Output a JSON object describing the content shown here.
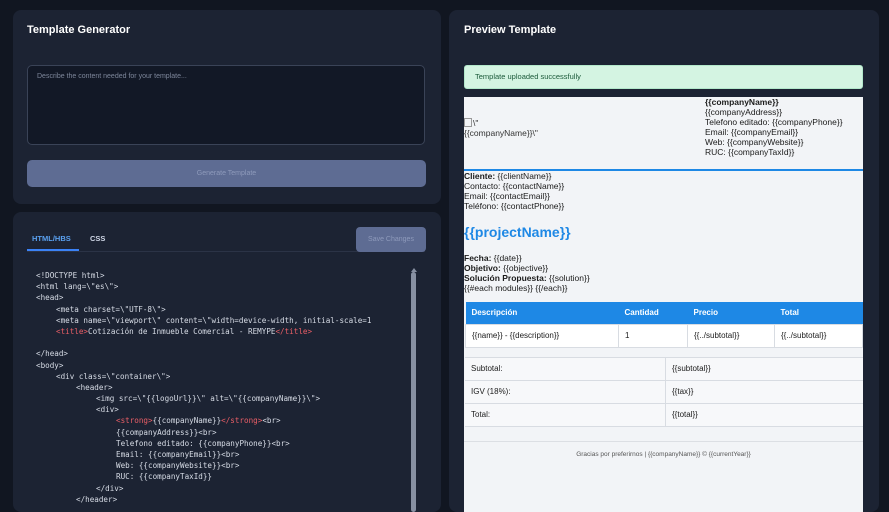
{
  "generator": {
    "title": "Template Generator",
    "placeholder": "Describe the content needed for your template...",
    "generate_label": "Generate Template"
  },
  "editor": {
    "tabs": [
      "HTML/HBS",
      "CSS"
    ],
    "save_label": "Save Changes",
    "code_lines": [
      {
        "i": 0,
        "p": [
          [
            "",
            "<!DOCTYPE html>"
          ]
        ]
      },
      {
        "i": 0,
        "p": [
          [
            "",
            "<html lang=\\\"es\\\">"
          ]
        ]
      },
      {
        "i": 0,
        "p": [
          [
            "",
            "<head>"
          ]
        ]
      },
      {
        "i": 1,
        "p": [
          [
            "",
            "<meta charset=\\\"UTF-8\\\">"
          ]
        ]
      },
      {
        "i": 1,
        "p": [
          [
            "",
            "<meta name=\\\"viewport\\\" content=\\\"width=device-width, initial-scale=1"
          ]
        ]
      },
      {
        "i": 1,
        "p": [
          [
            "t",
            "<title>"
          ],
          [
            "",
            "Cotización de Inmueble Comercial - REMYPE"
          ],
          [
            "t",
            "</title>"
          ]
        ]
      },
      {
        "i": 0,
        "p": [
          [
            "",
            ""
          ]
        ]
      },
      {
        "i": 0,
        "p": [
          [
            "",
            "</head>"
          ]
        ]
      },
      {
        "i": 0,
        "p": [
          [
            "",
            "<body>"
          ]
        ]
      },
      {
        "i": 1,
        "p": [
          [
            "",
            "<div class=\\\"container\\\">"
          ]
        ]
      },
      {
        "i": 2,
        "p": [
          [
            "",
            "<header>"
          ]
        ]
      },
      {
        "i": 3,
        "p": [
          [
            "",
            "<img src=\\\"{{logoUrl}}\\\" alt=\\\"{{companyName}}\\\">"
          ]
        ]
      },
      {
        "i": 3,
        "p": [
          [
            "",
            "<div>"
          ]
        ]
      },
      {
        "i": 4,
        "p": [
          [
            "t",
            "<strong>"
          ],
          [
            "",
            "{{companyName}}"
          ],
          [
            "t",
            "</strong>"
          ],
          [
            "",
            "<br>"
          ]
        ]
      },
      {
        "i": 4,
        "p": [
          [
            "",
            "{{companyAddress}}<br>"
          ]
        ]
      },
      {
        "i": 4,
        "p": [
          [
            "",
            "Telefono editado: {{companyPhone}}<br>"
          ]
        ]
      },
      {
        "i": 4,
        "p": [
          [
            "",
            "Email: {{companyEmail}}<br>"
          ]
        ]
      },
      {
        "i": 4,
        "p": [
          [
            "",
            "Web: {{companyWebsite}}<br>"
          ]
        ]
      },
      {
        "i": 4,
        "p": [
          [
            "",
            "RUC: {{companyTaxId}}"
          ]
        ]
      },
      {
        "i": 3,
        "p": [
          [
            "",
            "</div>"
          ]
        ]
      },
      {
        "i": 2,
        "p": [
          [
            "",
            "</header>"
          ]
        ]
      }
    ]
  },
  "preview": {
    "title": "Preview Template",
    "toast": "Template uploaded successfully",
    "logo_alt_1": "\\\"",
    "logo_alt_2": "{{companyName}}\\\"",
    "company": {
      "name": "{{companyName}}",
      "address": "{{companyAddress}}",
      "phone": "Telefono editado: {{companyPhone}}",
      "email": "Email: {{companyEmail}}",
      "web": "Web: {{companyWebsite}}",
      "ruc": "RUC: {{companyTaxId}}"
    },
    "client": {
      "cliente_label": "Cliente:",
      "cliente_value": " {{clientName}}",
      "contacto": "Contacto: {{contactName}}",
      "email": "Email: {{contactEmail}}",
      "telefono": "Teléfono: {{contactPhone}}"
    },
    "project_name": "{{projectName}}",
    "fecha_label": "Fecha:",
    "fecha_value": " {{date}}",
    "objetivo_label": "Objetivo:",
    "objetivo_value": " {{objective}}",
    "solucion_label": "Solución Propuesta:",
    "solucion_value": " {{solution}}",
    "each_line": "{{#each modules}} {{/each}}",
    "table_headers": [
      "Descripción",
      "Cantidad",
      "Precio",
      "Total"
    ],
    "table_row": [
      "{{name}} - {{description}}",
      "1",
      "{{../subtotal}}",
      "{{../subtotal}}"
    ],
    "totals": [
      {
        "label": "Subtotal:",
        "value": "{{subtotal}}"
      },
      {
        "label": "IGV (18%):",
        "value": "{{tax}}"
      },
      {
        "label": "Total:",
        "value": "{{total}}"
      }
    ],
    "footer": "Gracias por preferirnos | {{companyName}} © {{currentYear}}"
  }
}
